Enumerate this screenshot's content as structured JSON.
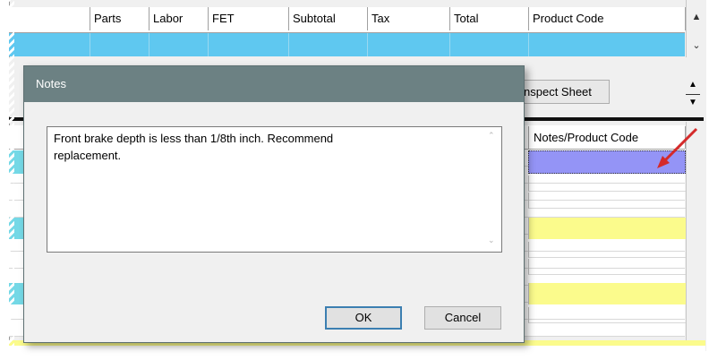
{
  "grid": {
    "columns": [
      "Parts",
      "Labor",
      "FET",
      "Subtotal",
      "Tax",
      "Total",
      "Product Code"
    ],
    "lower_header": "Notes/Product Code",
    "inspect_sheet_label": "nspect Sheet"
  },
  "dialog": {
    "title": "Notes",
    "notes_text": "Front brake depth is less than 1/8th inch. Recommend\nreplacement.",
    "ok_label": "OK",
    "cancel_label": "Cancel"
  },
  "colors": {
    "selected_row": "#5fc8f0",
    "highlight_yellow": "#fbfb8c",
    "active_cell": "#9494f6",
    "dialog_titlebar": "#6c8183",
    "arrow": "#d42a2a"
  }
}
